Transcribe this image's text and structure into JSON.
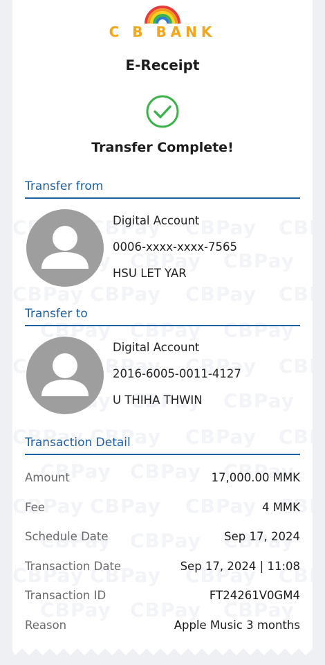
{
  "header": {
    "bank_name": "C B BANK",
    "title": "E-Receipt",
    "status": "Transfer Complete!"
  },
  "watermark_text": "CBPay",
  "transfer_from": {
    "heading": "Transfer from",
    "account_type": "Digital Account",
    "account_number": "0006-xxxx-xxxx-7565",
    "holder_name": "HSU LET YAR"
  },
  "transfer_to": {
    "heading": "Transfer to",
    "account_type": "Digital Account",
    "account_number": "2016-6005-0011-4127",
    "holder_name": "U THIHA THWIN"
  },
  "transaction_detail": {
    "heading": "Transaction Detail",
    "rows": [
      {
        "label": "Amount",
        "value": "17,000.00 MMK"
      },
      {
        "label": "Fee",
        "value": "4 MMK"
      },
      {
        "label": "Schedule Date",
        "value": "Sep 17, 2024"
      },
      {
        "label": "Transaction Date",
        "value": "Sep 17, 2024 | 11:08"
      },
      {
        "label": "Transaction ID",
        "value": "FT24261V0GM4"
      },
      {
        "label": "Reason",
        "value": "Apple Music 3 months"
      }
    ]
  },
  "colors": {
    "accent_blue": "#1d5fa3",
    "success_green": "#3cb34a",
    "brand_orange": "#f3a51c",
    "avatar_gray": "#9e9e9e"
  }
}
